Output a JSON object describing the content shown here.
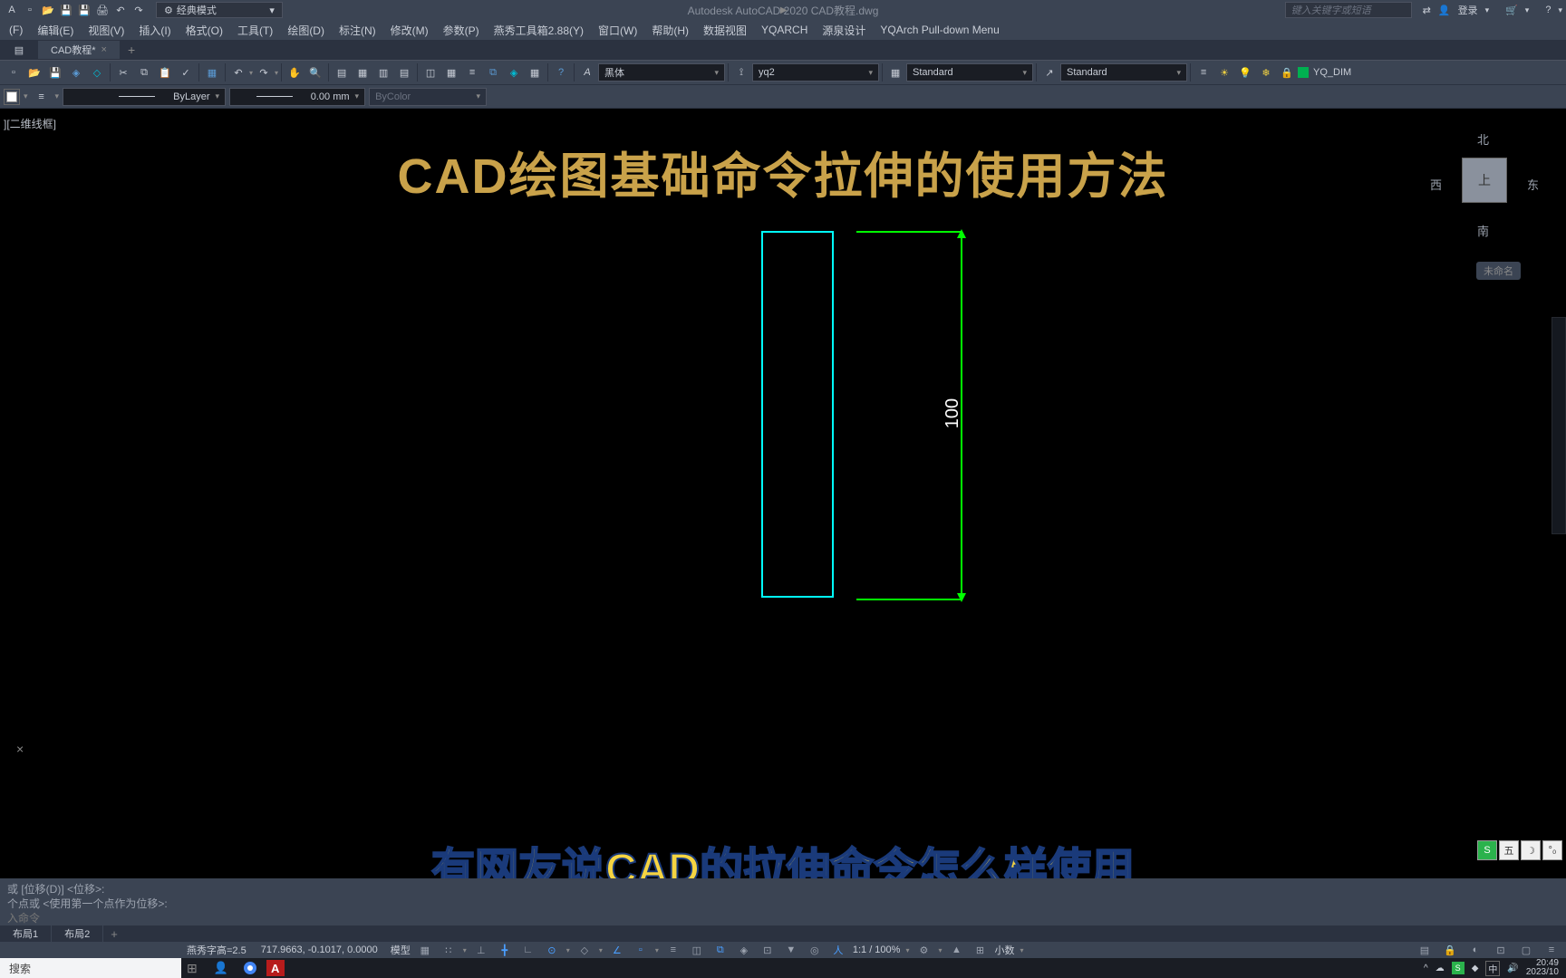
{
  "title_bar": {
    "workspace_label": "经典模式",
    "app_title": "Autodesk AutoCAD 2020   CAD教程.dwg",
    "search_placeholder": "键入关键字或短语",
    "login_label": "登录"
  },
  "menu": {
    "items": [
      "(F)",
      "编辑(E)",
      "视图(V)",
      "插入(I)",
      "格式(O)",
      "工具(T)",
      "绘图(D)",
      "标注(N)",
      "修改(M)",
      "参数(P)",
      "燕秀工具箱2.88(Y)",
      "窗口(W)",
      "帮助(H)",
      "数据视图",
      "YQARCH",
      "源泉设计",
      "YQArch Pull-down Menu"
    ]
  },
  "doc_tab": "CAD教程*",
  "toolbar1": {
    "font_select": "黑体",
    "style_select": "yq2",
    "dim_select": "Standard",
    "table_select": "Standard",
    "layer_label": "YQ_DIM"
  },
  "toolbar2": {
    "layer_select": "ByLayer",
    "lineweight_select": "0.00 mm",
    "color_select": "ByColor"
  },
  "viewport": {
    "label": "][二维线框]",
    "main_title": "CAD绘图基础命令拉伸的使用方法",
    "dim_value": "100"
  },
  "viewcube": {
    "north": "北",
    "south": "南",
    "east": "东",
    "west": "西",
    "top": "上",
    "unnamed": "未命名"
  },
  "subtitle": "有网友说CAD的拉伸命令怎么样使用",
  "command": {
    "line1": "或 [位移(D)] <位移>:",
    "line2": "个点或 <使用第一个点作为位移>:",
    "line3": "入命令"
  },
  "ime": {
    "letter": "五",
    "moon": "☽",
    "dots": "°₀"
  },
  "layout_tabs": [
    "布局1",
    "布局2"
  ],
  "status": {
    "text_height": "燕秀字高=2.5",
    "coords": "717.9663, -0.1017, 0.0000",
    "model": "模型",
    "scale": "1:1 / 100%",
    "decimal": "小数"
  },
  "taskbar": {
    "search": "搜索",
    "ime_lang": "中",
    "time": "20:49",
    "date": "2023/10"
  }
}
